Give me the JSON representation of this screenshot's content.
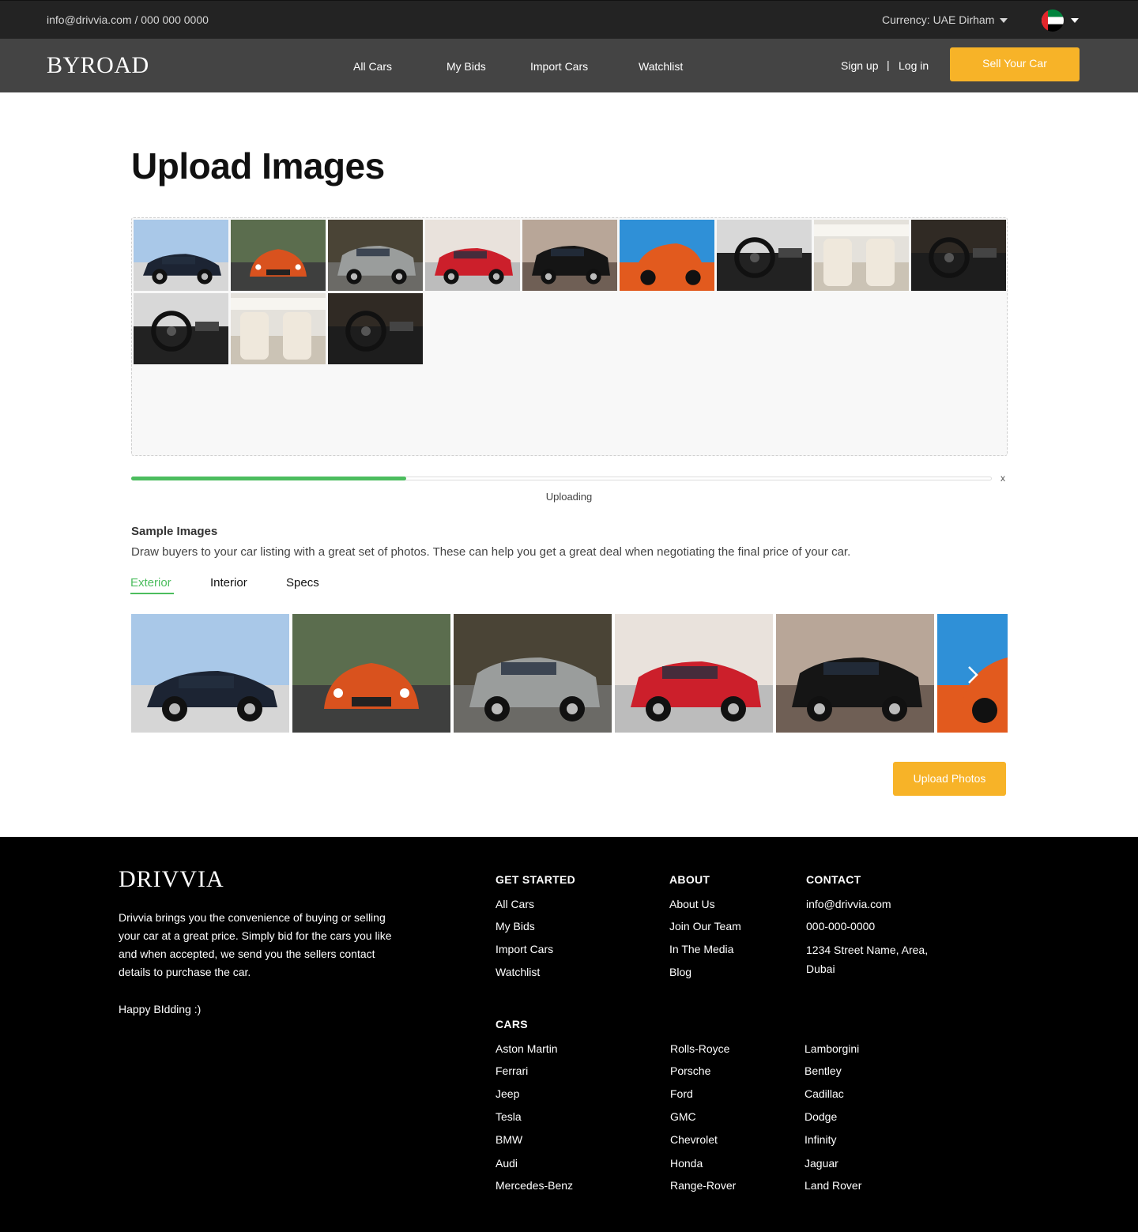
{
  "topbar": {
    "contact": "info@drivvia.com / 000 000 0000",
    "currency": "Currency: UAE Dirham",
    "flag_icon": "uae-flag-icon"
  },
  "nav": {
    "logo": "BYROAD",
    "links": [
      "All Cars",
      "My Bids",
      "Import Cars",
      "Watchlist"
    ],
    "signup": "Sign up",
    "separator": "|",
    "login": "Log in",
    "sell_button": "Sell Your Car"
  },
  "main": {
    "title": "Upload Images",
    "uploaded_count": 12,
    "progress": {
      "percent": 32,
      "close_label": "x",
      "status": "Uploading"
    },
    "sample": {
      "title": "Sample Images",
      "description": "Draw buyers to your car listing with a great set of photos. These can help you get a great deal when negotiating the final price of your car.",
      "tabs": [
        "Exterior",
        "Interior",
        "Specs"
      ],
      "active_tab": "Exterior"
    },
    "upload_button": "Upload Photos"
  },
  "colors": {
    "accent": "#f7b328",
    "progress": "#4cbd5e",
    "topbar": "#232323",
    "navbar": "#444444",
    "footer": "#000000"
  },
  "footer": {
    "logo": "DRIVVIA",
    "about": "Drivvia brings you the convenience of buying or selling your car at a great price. Simply bid for the cars you like and when accepted, we send you the sellers contact details to purchase the car.",
    "happy": "Happy BIdding :)",
    "get_started": {
      "title": "GET STARTED",
      "links": [
        "All Cars",
        "My Bids",
        "Import Cars",
        "Watchlist"
      ]
    },
    "about_col": {
      "title": "ABOUT",
      "links": [
        "About Us",
        "Join Our Team",
        "In The Media",
        "Blog"
      ]
    },
    "contact": {
      "title": "CONTACT",
      "email": "info@drivvia.com",
      "phone": "000-000-0000",
      "address": "1234 Street Name, Area, Dubai"
    },
    "cars": {
      "title": "CARS",
      "col1": [
        "Aston Martin",
        "Ferrari",
        "Jeep",
        "Tesla",
        "BMW",
        "Audi",
        "Mercedes-Benz"
      ],
      "col2": [
        "Rolls-Royce",
        "Porsche",
        "Ford",
        "GMC",
        "Chevrolet",
        "Honda",
        "Range-Rover"
      ],
      "col3": [
        "Lamborgini",
        "Bentley",
        "Cadillac",
        "Dodge",
        "Infinity",
        "Jaguar",
        "Land Rover"
      ]
    }
  }
}
